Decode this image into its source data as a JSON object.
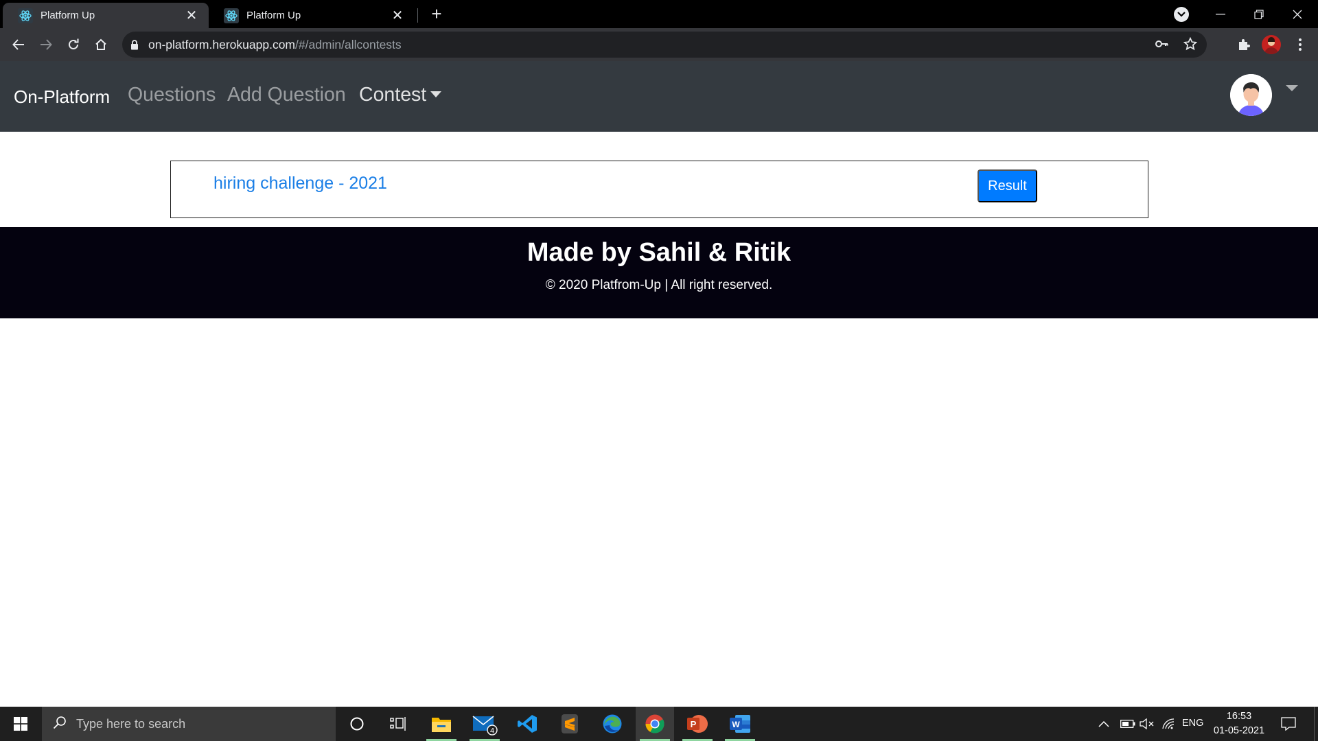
{
  "browser": {
    "tabs": [
      {
        "title": "Platform Up",
        "active": true
      },
      {
        "title": "Platform Up",
        "active": false
      }
    ],
    "address": {
      "host": "on-platform.herokuapp.com",
      "path": "/#/admin/allcontests"
    }
  },
  "navbar": {
    "brand": "On-Platform",
    "links": {
      "questions": "Questions",
      "add_question": "Add Question",
      "contest": "Contest"
    }
  },
  "contests": [
    {
      "name": "hiring challenge - 2021",
      "action_label": "Result"
    }
  ],
  "footer": {
    "title": "Made by Sahil & Ritik",
    "copyright": "© 2020 Platfrom-Up | All right reserved."
  },
  "taskbar": {
    "search_placeholder": "Type here to search",
    "mail_badge": "4",
    "language": "ENG",
    "time": "16:53",
    "date": "01-05-2021"
  },
  "colors": {
    "navbar_bg": "#343a40",
    "link_blue": "#1a7ee6",
    "button_blue": "#007bff",
    "footer_bg": "#04020f"
  },
  "icons": [
    "react-favicon-icon",
    "close-icon",
    "plus-icon",
    "back-icon",
    "forward-icon",
    "reload-icon",
    "home-icon",
    "lock-icon",
    "key-icon",
    "star-icon",
    "extensions-icon",
    "profile-icon",
    "menu-icon",
    "user-avatar-icon",
    "windows-start-icon",
    "search-icon",
    "cortana-icon",
    "task-view-icon",
    "file-explorer-icon",
    "mail-icon",
    "vscode-icon",
    "sublime-icon",
    "edge-icon",
    "chrome-icon",
    "powerpoint-icon",
    "word-icon",
    "chevron-up-icon",
    "battery-icon",
    "volume-muted-icon",
    "wifi-icon",
    "notification-icon"
  ]
}
